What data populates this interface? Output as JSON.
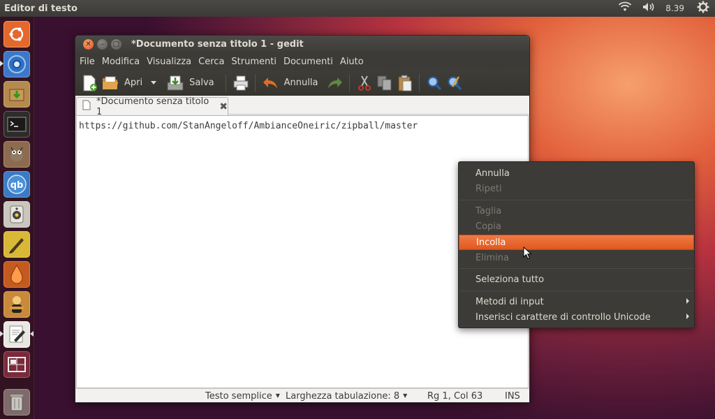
{
  "top_panel": {
    "app_title": "Editor di testo",
    "clock": "8.39",
    "icons": [
      "wifi-icon",
      "volume-icon",
      "gear-icon"
    ]
  },
  "launcher": {
    "items": [
      "ubuntu-dash-icon",
      "chromium-icon",
      "software-center-icon",
      "terminal-icon",
      "gimp-icon",
      "qbittorrent-icon",
      "speaker-icon",
      "pen-tool-icon",
      "inkdrop-icon",
      "vlc-icon",
      "gedit-icon",
      "workspace-switcher-icon",
      "trash-icon"
    ]
  },
  "window": {
    "title": "*Documento senza titolo 1 - gedit",
    "menu": [
      "File",
      "Modifica",
      "Visualizza",
      "Cerca",
      "Strumenti",
      "Documenti",
      "Aiuto"
    ],
    "toolbar": {
      "open_label": "Apri",
      "save_label": "Salva",
      "undo_label": "Annulla"
    },
    "tab_label": "*Documento senza titolo 1",
    "editor_text": "https://github.com/StanAngeloff/AmbianceOneiric/zipball/master",
    "status": {
      "language": "Testo semplice",
      "tab_width": "Larghezza tabulazione:  8",
      "position": "Rg 1, Col 63",
      "mode": "INS"
    }
  },
  "context_menu": {
    "items": [
      {
        "label": "Annulla"
      },
      {
        "label": "Ripeti"
      },
      {
        "label": "Taglia"
      },
      {
        "label": "Copia"
      },
      {
        "label": "Incolla"
      },
      {
        "label": "Elimina"
      },
      {
        "label": "Seleziona tutto"
      },
      {
        "label": "Metodi di input"
      },
      {
        "label": "Inserisci carattere di controllo Unicode"
      }
    ],
    "highlighted": "Incolla",
    "highlight_color": "#e95420"
  }
}
